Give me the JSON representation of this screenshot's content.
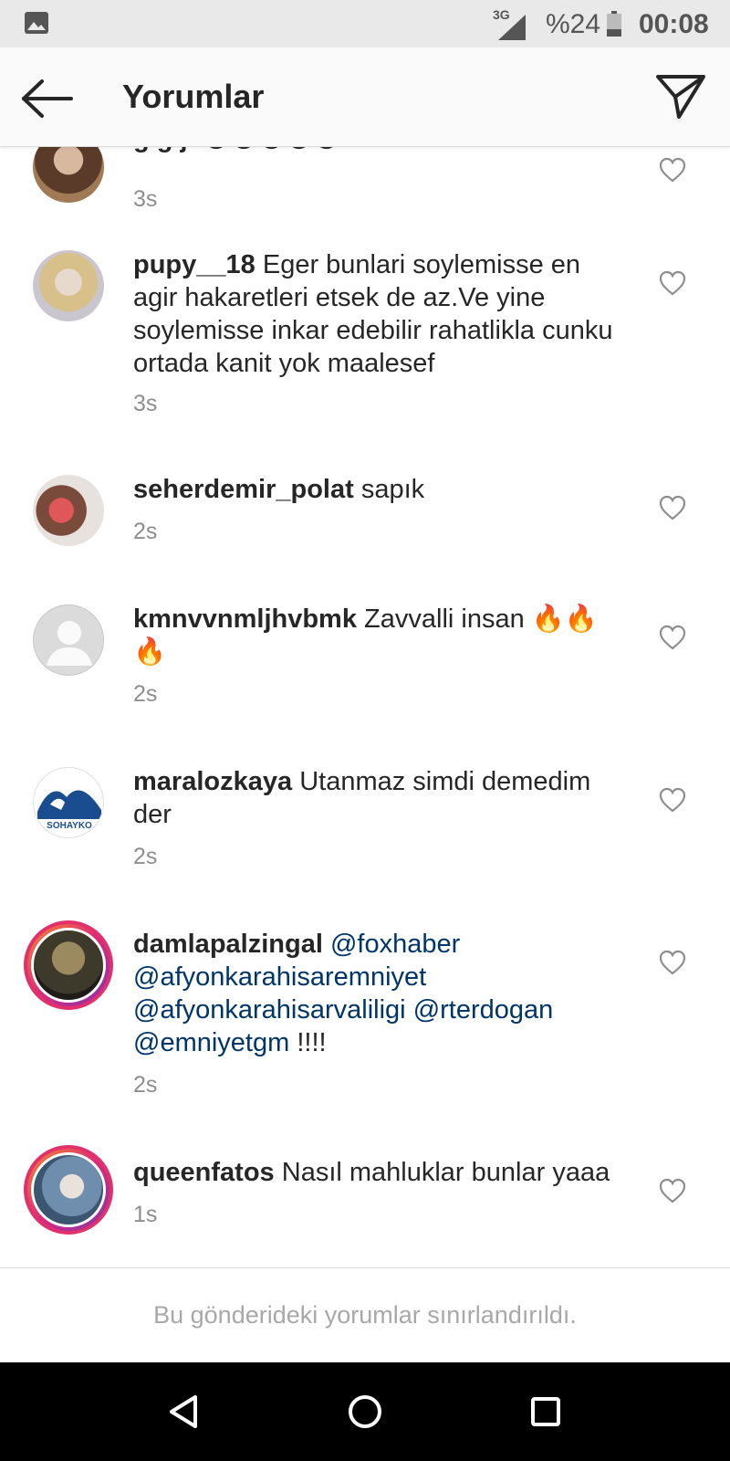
{
  "status_bar": {
    "network": "3G",
    "battery": "%24",
    "time": "00:08",
    "icons": [
      "image-icon",
      "signal-icon",
      "battery-icon"
    ]
  },
  "header": {
    "title": "Yorumlar",
    "back_icon": "arrow-left-icon",
    "send_icon": "paper-plane-icon"
  },
  "comments": [
    {
      "username": "g.g.j.",
      "text": "😡😡😡😡😡",
      "time": "3s"
    },
    {
      "username": "pupy__18",
      "text": "Eger bunlari soylemisse en agir hakaretleri etsek de az.Ve yine soylemisse inkar edebilir rahatlikla cunku ortada kanit yok maalesef",
      "time": "3s"
    },
    {
      "username": "seherdemir_polat",
      "text": "sapık",
      "time": "2s"
    },
    {
      "username": "kmnvvnmljhvbmk",
      "text": "Zavvalli insan 🔥🔥🔥",
      "time": "2s"
    },
    {
      "username": "maralozkaya",
      "text": "Utanmaz simdi demedim der",
      "time": "2s",
      "avatar_text": "SOHAYKO"
    },
    {
      "username": "damlapalzingal",
      "mentions": [
        "@foxhaber",
        "@afyonkarahisaremniyet",
        "@afyonkarahisarvaliligi",
        "@rterdogan",
        "@emniyetgm"
      ],
      "suffix": "!!!!",
      "time": "2s"
    },
    {
      "username": "queenfatos",
      "text": "Nasıl mahluklar bunlar yaaa",
      "time": "1s"
    }
  ],
  "footer": {
    "text": "Bu gönderideki yorumlar sınırlandırıldı."
  },
  "nav_bar": {
    "icons": [
      "back-triangle-icon",
      "home-circle-icon",
      "recents-square-icon"
    ]
  },
  "colors": {
    "mention": "#003569",
    "timestamp": "#8e8e8e",
    "story_ring": "#e1306c"
  }
}
